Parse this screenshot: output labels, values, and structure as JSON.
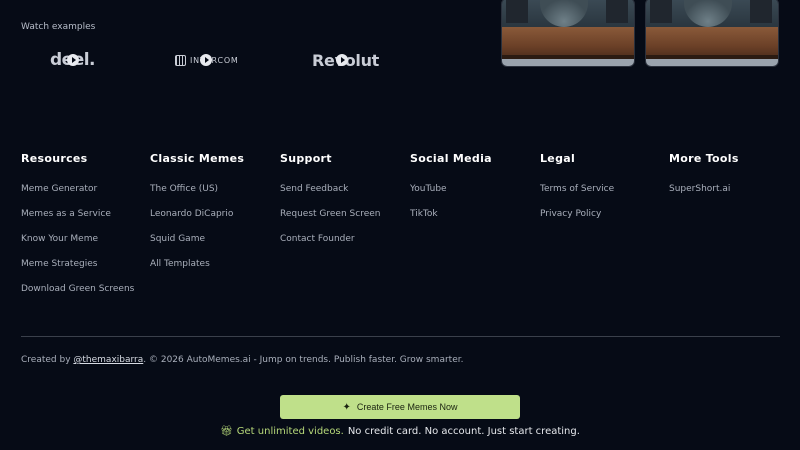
{
  "watch_examples": {
    "label": "Watch examples",
    "logos": [
      {
        "name": "deel."
      },
      {
        "name": "INTERCOM"
      },
      {
        "name": "Revolut"
      }
    ]
  },
  "footer": {
    "columns": [
      {
        "heading": "Resources",
        "links": [
          "Meme Generator",
          "Memes as a Service",
          "Know Your Meme",
          "Meme Strategies",
          "Download Green Screens"
        ]
      },
      {
        "heading": "Classic Memes",
        "links": [
          "The Office (US)",
          "Leonardo DiCaprio",
          "Squid Game",
          "All Templates"
        ]
      },
      {
        "heading": "Support",
        "links": [
          "Send Feedback",
          "Request Green Screen",
          "Contact Founder"
        ]
      },
      {
        "heading": "Social Media",
        "links": [
          "YouTube",
          "TikTok"
        ]
      },
      {
        "heading": "Legal",
        "links": [
          "Terms of Service",
          "Privacy Policy"
        ]
      },
      {
        "heading": "More Tools",
        "links": [
          "SuperShort.ai"
        ]
      }
    ],
    "credits": {
      "prefix": "Created by ",
      "handle": "@themaxibarra",
      "suffix": ". © 2026 AutoMemes.ai - Jump on trends. Publish faster. Grow smarter."
    }
  },
  "cta": {
    "label": "Create Free Memes Now",
    "icon": "sparkle-icon",
    "tagline_highlight": "Get unlimited videos.",
    "tagline_rest": "No credit card. No account. Just start creating.",
    "tagline_icon": "gift-icon",
    "accent_color": "#bfe08a"
  }
}
